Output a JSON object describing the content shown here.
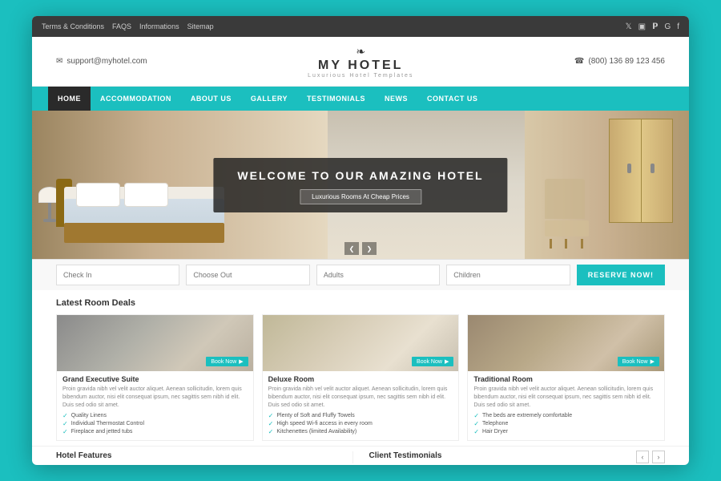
{
  "topbar": {
    "links": [
      "Terms & Conditions",
      "FAQS",
      "Informations",
      "Sitemap"
    ],
    "social_icons": [
      "twitter",
      "rss",
      "pinterest",
      "google",
      "facebook"
    ]
  },
  "header": {
    "email": "support@myhotel.com",
    "logo_crown": "❧",
    "logo_text": "MY HOTEL",
    "logo_tagline": "Luxurious Hotel Templates",
    "phone": "(800) 136 89 123 456"
  },
  "nav": {
    "items": [
      {
        "label": "HOME",
        "active": true
      },
      {
        "label": "ACCOMMODATION",
        "active": false
      },
      {
        "label": "ABOUT US",
        "active": false
      },
      {
        "label": "GALLERY",
        "active": false
      },
      {
        "label": "TESTIMONIALS",
        "active": false
      },
      {
        "label": "NEWS",
        "active": false
      },
      {
        "label": "CONTACT US",
        "active": false
      }
    ]
  },
  "hero": {
    "title": "WELCOME TO OUR AMAZING HOTEL",
    "subtitle": "Luxurious Rooms At Cheap Prices",
    "arrow_prev": "❮",
    "arrow_next": "❯"
  },
  "booking": {
    "checkin_placeholder": "Check In",
    "checkout_placeholder": "Choose Out",
    "adults_placeholder": "Adults",
    "children_placeholder": "Children",
    "reserve_label": "RESERVE NOW!"
  },
  "rooms": {
    "section_title": "Latest Room Deals",
    "items": [
      {
        "name": "Grand Executive Suite",
        "tag": "Book Now",
        "desc": "Proin gravida nibh vel velit auctor aliquet. Aenean sollicitudin, lorem quis bibendum auctor, nisi elit consequat ipsum, nec sagittis sem nibh id elit. Duis sed odio sit amet.",
        "features": [
          "Quality Linens",
          "Individual Thermostat Control",
          "Fireplace and jetted tubs"
        ]
      },
      {
        "name": "Deluxe Room",
        "tag": "Book Now",
        "desc": "Proin gravida nibh vel velit auctor aliquet. Aenean sollicitudin, lorem quis bibendum auctor, nisi elit consequat ipsum, nec sagittis sem nibh id elit. Duis sed odio sit amet.",
        "features": [
          "Plenty of Soft and Fluffy Towels",
          "High speed Wi-fi access in every room",
          "Kitchenettes (limited Availability)"
        ]
      },
      {
        "name": "Traditional Room",
        "tag": "Book Now",
        "desc": "Proin gravida nibh vel velit auctor aliquet. Aenean sollicitudin, lorem quis bibendum auctor, nisi elit consequat ipsum, nec sagittis sem nibh id elit. Duis sed odio sit amet.",
        "features": [
          "The beds are extremely comfortable",
          "Telephone",
          "Hair Dryer"
        ]
      }
    ]
  },
  "hotel_features": {
    "title": "Hotel Features"
  },
  "client_testimonials": {
    "title": "Client Testimonials",
    "nav_prev": "‹",
    "nav_next": "›"
  }
}
